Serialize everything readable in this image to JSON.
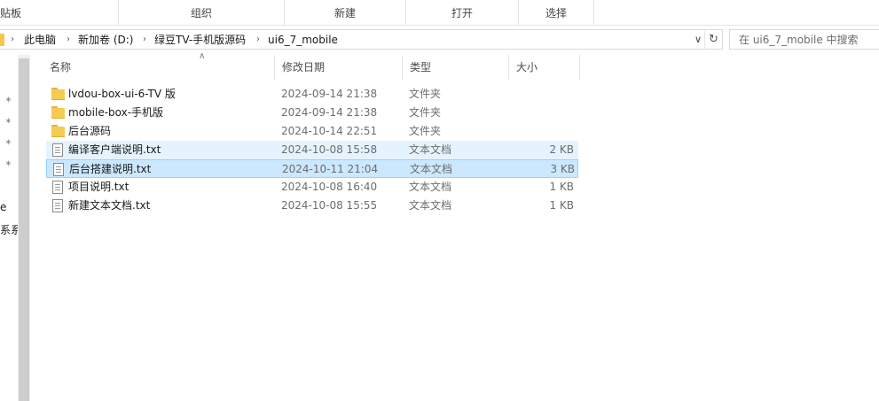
{
  "ribbon": {
    "groups": [
      "贴板",
      "组织",
      "新建",
      "打开",
      "选择"
    ]
  },
  "address": {
    "crumbs": [
      "此电脑",
      "新加卷 (D:)",
      "绿豆TV-手机版源码",
      "ui6_7_mobile"
    ],
    "dropdown_icon": "chevron-down-icon",
    "refresh_icon": "refresh-icon"
  },
  "search": {
    "placeholder": "在 ui6_7_mobile 中搜索"
  },
  "nav": {
    "partial_labels": [
      "e",
      "系系"
    ]
  },
  "columns": {
    "name": "名称",
    "date": "修改日期",
    "type": "类型",
    "size": "大小"
  },
  "files": [
    {
      "name": "lvdou-box-ui-6-TV 版",
      "date": "2024-09-14 21:38",
      "type": "文件夹",
      "size": "",
      "icon": "folder-icon",
      "state": "normal"
    },
    {
      "name": "mobile-box-手机版",
      "date": "2024-09-14 21:38",
      "type": "文件夹",
      "size": "",
      "icon": "folder-icon",
      "state": "normal"
    },
    {
      "name": "后台源码",
      "date": "2024-10-14 22:51",
      "type": "文件夹",
      "size": "",
      "icon": "folder-icon",
      "state": "normal"
    },
    {
      "name": "编译客户端说明.txt",
      "date": "2024-10-08 15:58",
      "type": "文本文档",
      "size": "2 KB",
      "icon": "text-file-icon",
      "state": "hover"
    },
    {
      "name": "后台搭建说明.txt",
      "date": "2024-10-11 21:04",
      "type": "文本文档",
      "size": "3 KB",
      "icon": "text-file-icon",
      "state": "selected"
    },
    {
      "name": "项目说明.txt",
      "date": "2024-10-08 16:40",
      "type": "文本文档",
      "size": "1 KB",
      "icon": "text-file-icon",
      "state": "normal"
    },
    {
      "name": "新建文本文档.txt",
      "date": "2024-10-08 15:55",
      "type": "文本文档",
      "size": "1 KB",
      "icon": "text-file-icon",
      "state": "normal"
    }
  ],
  "colors": {
    "hover_row": "#e5f3ff",
    "selected_row": "#cce8ff",
    "selected_border": "#99d1ff",
    "folder": "#f5cb52"
  }
}
